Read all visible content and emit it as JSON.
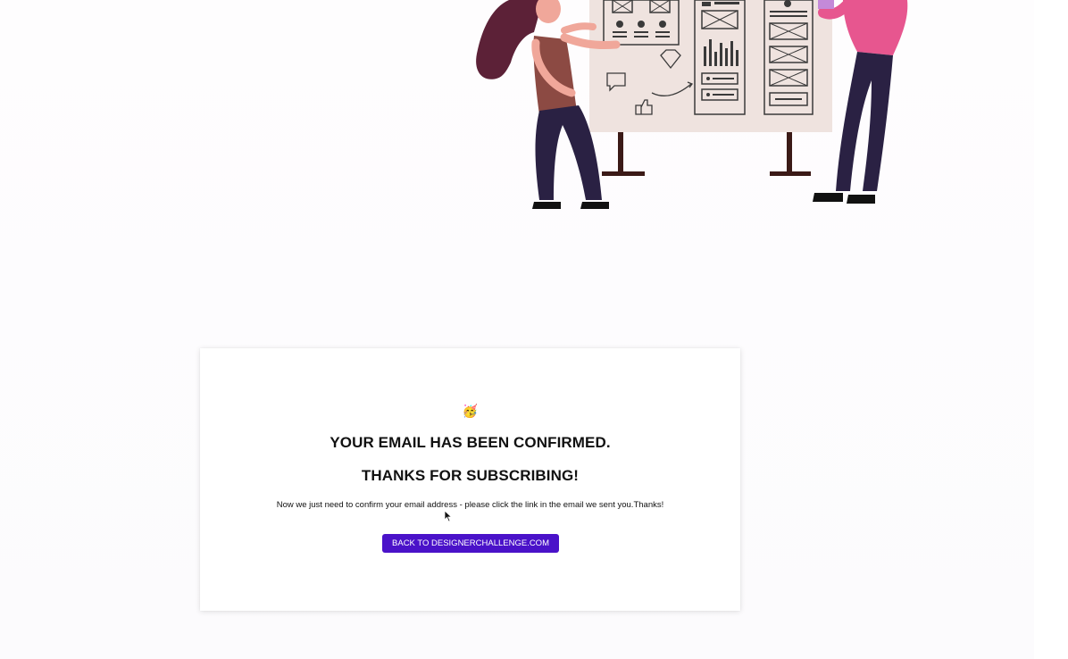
{
  "illustration": {
    "icon": "design-team-illustration"
  },
  "card": {
    "emoji": "🥳",
    "title_line1": "YOUR EMAIL HAS BEEN CONFIRMED.",
    "title_line2": "THANKS FOR SUBSCRIBING!",
    "message": "Now we just need to confirm your email address - please click the link in the email we sent you.Thanks!",
    "button_label": "BACK TO DESIGNERCHALLENGE.COM"
  },
  "colors": {
    "accent": "#4a12c9",
    "board": "#efe3df",
    "person_pink": "#e7568f",
    "person_dark": "#2a2143"
  }
}
